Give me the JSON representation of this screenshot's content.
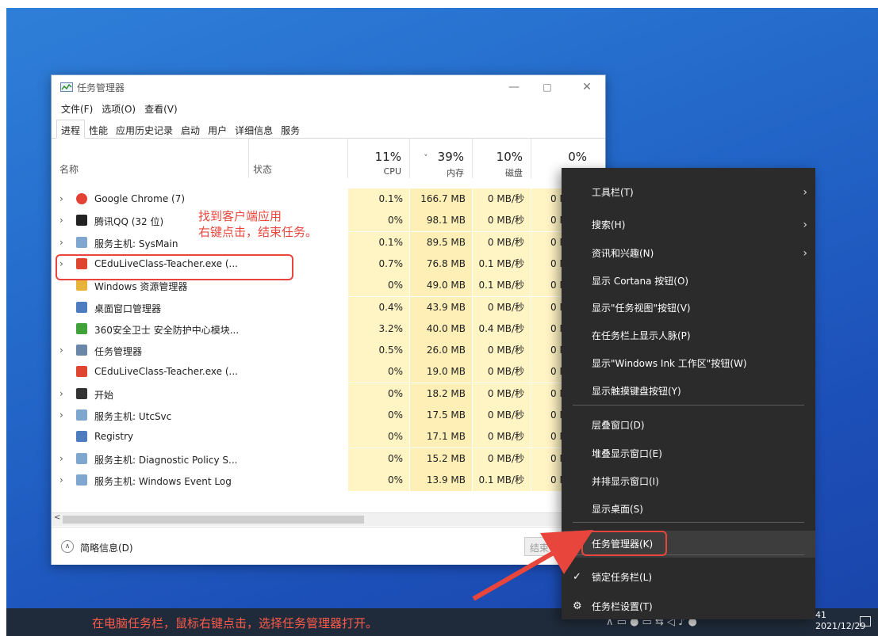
{
  "window": {
    "title": "任务管理器",
    "min": "—",
    "max": "□",
    "close": "✕"
  },
  "menu": [
    "文件(F)",
    "选项(O)",
    "查看(V)"
  ],
  "tabs": [
    "进程",
    "性能",
    "应用历史记录",
    "启动",
    "用户",
    "详细信息",
    "服务"
  ],
  "header": {
    "name": "名称",
    "status": "状态",
    "cpu_pct": "11%",
    "cpu": "CPU",
    "mem_pct": "39%",
    "mem": "内存",
    "disk_pct": "10%",
    "disk": "磁盘",
    "net_pct": "0%",
    "sort_glyph": "˅"
  },
  "processes": [
    {
      "name": "Google Chrome (7)",
      "expand": true,
      "icon": "chrome-icon",
      "cpu": "0.1%",
      "mem": "166.7 MB",
      "disk": "0 MB/秒",
      "net": "0 N"
    },
    {
      "name": "腾讯QQ (32 位)",
      "expand": true,
      "icon": "qq-icon",
      "cpu": "0%",
      "mem": "98.1 MB",
      "disk": "0 MB/秒",
      "net": "0 N"
    },
    {
      "name": "服务主机: SysMain",
      "expand": true,
      "icon": "service-host-icon",
      "cpu": "0.1%",
      "mem": "89.5 MB",
      "disk": "0 MB/秒",
      "net": "0 N"
    },
    {
      "name": "CEduLiveClass-Teacher.exe (...",
      "expand": true,
      "icon": "cedu-icon",
      "cpu": "0.7%",
      "mem": "76.8 MB",
      "disk": "0.1 MB/秒",
      "net": "0 N"
    },
    {
      "name": "Windows 资源管理器",
      "expand": false,
      "icon": "explorer-icon",
      "cpu": "0%",
      "mem": "49.0 MB",
      "disk": "0.1 MB/秒",
      "net": "0 N"
    },
    {
      "name": "桌面窗口管理器",
      "expand": false,
      "icon": "dwm-icon",
      "cpu": "0.4%",
      "mem": "43.9 MB",
      "disk": "0 MB/秒",
      "net": "0 N"
    },
    {
      "name": "360安全卫士 安全防护中心模块...",
      "expand": false,
      "icon": "360-icon",
      "cpu": "3.2%",
      "mem": "40.0 MB",
      "disk": "0.4 MB/秒",
      "net": "0 N"
    },
    {
      "name": "任务管理器",
      "expand": true,
      "icon": "task-manager-icon",
      "cpu": "0.5%",
      "mem": "26.0 MB",
      "disk": "0 MB/秒",
      "net": "0 N"
    },
    {
      "name": "CEduLiveClass-Teacher.exe (...",
      "expand": false,
      "icon": "cedu-icon",
      "cpu": "0%",
      "mem": "19.0 MB",
      "disk": "0 MB/秒",
      "net": "0 N"
    },
    {
      "name": "开始",
      "expand": true,
      "icon": "start-icon",
      "cpu": "0%",
      "mem": "18.2 MB",
      "disk": "0 MB/秒",
      "net": "0 N"
    },
    {
      "name": "服务主机: UtcSvc",
      "expand": true,
      "icon": "service-host-icon",
      "cpu": "0%",
      "mem": "17.5 MB",
      "disk": "0 MB/秒",
      "net": "0 N"
    },
    {
      "name": "Registry",
      "expand": false,
      "icon": "registry-icon",
      "cpu": "0%",
      "mem": "17.1 MB",
      "disk": "0 MB/秒",
      "net": "0 N"
    },
    {
      "name": "服务主机: Diagnostic Policy S...",
      "expand": true,
      "icon": "service-host-icon",
      "cpu": "0%",
      "mem": "15.2 MB",
      "disk": "0 MB/秒",
      "net": "0 N"
    },
    {
      "name": "服务主机: Windows Event Log",
      "expand": true,
      "icon": "service-host-icon",
      "cpu": "0%",
      "mem": "13.9 MB",
      "disk": "0.1 MB/秒",
      "net": "0 N"
    }
  ],
  "footer": {
    "fewer_details": "简略信息(D)",
    "end_task": "结束"
  },
  "context_menu": {
    "items": [
      {
        "label": "工具栏(T)",
        "submenu": true
      },
      {
        "label": "搜索(H)",
        "submenu": true
      },
      {
        "label": "资讯和兴趣(N)",
        "submenu": true
      },
      {
        "label": "显示 Cortana 按钮(O)"
      },
      {
        "label": "显示\"任务视图\"按钮(V)"
      },
      {
        "label": "在任务栏上显示人脉(P)"
      },
      {
        "label": "显示\"Windows Ink 工作区\"按钮(W)"
      },
      {
        "label": "显示触摸键盘按钮(Y)"
      },
      {
        "label": "层叠窗口(D)"
      },
      {
        "label": "堆叠显示窗口(E)"
      },
      {
        "label": "并排显示窗口(I)"
      },
      {
        "label": "显示桌面(S)"
      },
      {
        "label": "任务管理器(K)"
      },
      {
        "label": "锁定任务栏(L)"
      },
      {
        "label": "任务栏设置(T)"
      }
    ],
    "submenu_arrow": "›",
    "check": "✓",
    "gear": "⚙"
  },
  "annotations": {
    "line1": "找到客户端应用",
    "line2": "右键点击，结束任务。",
    "taskbar_caption": "在电脑任务栏，鼠标右键点击，选择任务管理器打开。"
  },
  "taskbar": {
    "time": "41",
    "date": "2021/12/29"
  },
  "colors": {
    "annotation": "#e8463d",
    "menu_bg": "#2b2b2b",
    "cpu_shade": "#fff4c4"
  }
}
